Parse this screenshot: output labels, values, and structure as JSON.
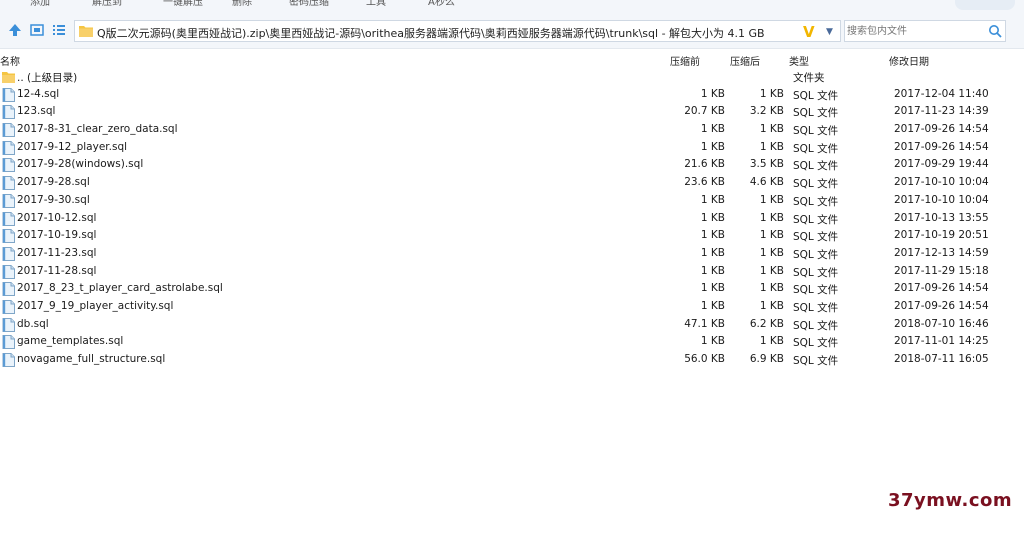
{
  "toolbar": {
    "items": [
      "添加",
      "解压到",
      "一键解压",
      "删除",
      "密码压缩",
      "工具",
      "A秒么"
    ]
  },
  "address": {
    "path": "Q版二次元源码(奥里西娅战记).zip\\奥里西娅战记-源码\\orithea服务器端源代码\\奥莉西娅服务器端源代码\\trunk\\sql - 解包大小为 4.1 GB",
    "logo_letter": "V"
  },
  "search": {
    "placeholder": "搜索包内文件"
  },
  "columns": {
    "name": "名称",
    "compressed": "压缩前",
    "original": "压缩后",
    "type": "类型",
    "modified": "修改日期"
  },
  "parent": {
    "name": ".. (上级目录)",
    "type": "文件夹"
  },
  "files": [
    {
      "name": "12-4.sql",
      "compressed": "1 KB",
      "original": "1 KB",
      "type": "SQL 文件",
      "date": "2017-12-04 11:40"
    },
    {
      "name": "123.sql",
      "compressed": "20.7 KB",
      "original": "3.2 KB",
      "type": "SQL 文件",
      "date": "2017-11-23 14:39"
    },
    {
      "name": "2017-8-31_clear_zero_data.sql",
      "compressed": "1 KB",
      "original": "1 KB",
      "type": "SQL 文件",
      "date": "2017-09-26 14:54"
    },
    {
      "name": "2017-9-12_player.sql",
      "compressed": "1 KB",
      "original": "1 KB",
      "type": "SQL 文件",
      "date": "2017-09-26 14:54"
    },
    {
      "name": "2017-9-28(windows).sql",
      "compressed": "21.6 KB",
      "original": "3.5 KB",
      "type": "SQL 文件",
      "date": "2017-09-29 19:44"
    },
    {
      "name": "2017-9-28.sql",
      "compressed": "23.6 KB",
      "original": "4.6 KB",
      "type": "SQL 文件",
      "date": "2017-10-10 10:04"
    },
    {
      "name": "2017-9-30.sql",
      "compressed": "1 KB",
      "original": "1 KB",
      "type": "SQL 文件",
      "date": "2017-10-10 10:04"
    },
    {
      "name": "2017-10-12.sql",
      "compressed": "1 KB",
      "original": "1 KB",
      "type": "SQL 文件",
      "date": "2017-10-13 13:55"
    },
    {
      "name": "2017-10-19.sql",
      "compressed": "1 KB",
      "original": "1 KB",
      "type": "SQL 文件",
      "date": "2017-10-19 20:51"
    },
    {
      "name": "2017-11-23.sql",
      "compressed": "1 KB",
      "original": "1 KB",
      "type": "SQL 文件",
      "date": "2017-12-13 14:59"
    },
    {
      "name": "2017-11-28.sql",
      "compressed": "1 KB",
      "original": "1 KB",
      "type": "SQL 文件",
      "date": "2017-11-29 15:18"
    },
    {
      "name": "2017_8_23_t_player_card_astrolabe.sql",
      "compressed": "1 KB",
      "original": "1 KB",
      "type": "SQL 文件",
      "date": "2017-09-26 14:54"
    },
    {
      "name": "2017_9_19_player_activity.sql",
      "compressed": "1 KB",
      "original": "1 KB",
      "type": "SQL 文件",
      "date": "2017-09-26 14:54"
    },
    {
      "name": "db.sql",
      "compressed": "47.1 KB",
      "original": "6.2 KB",
      "type": "SQL 文件",
      "date": "2018-07-10 16:46"
    },
    {
      "name": "game_templates.sql",
      "compressed": "1 KB",
      "original": "1 KB",
      "type": "SQL 文件",
      "date": "2017-11-01 14:25"
    },
    {
      "name": "novagame_full_structure.sql",
      "compressed": "56.0 KB",
      "original": "6.9 KB",
      "type": "SQL 文件",
      "date": "2018-07-11 16:05"
    }
  ],
  "watermark": "37ymw.com",
  "colors": {
    "folder": "#f5c542",
    "nav_blue": "#3b8fd9",
    "accent_yellow": "#f2b600",
    "watermark": "#7a1020"
  }
}
